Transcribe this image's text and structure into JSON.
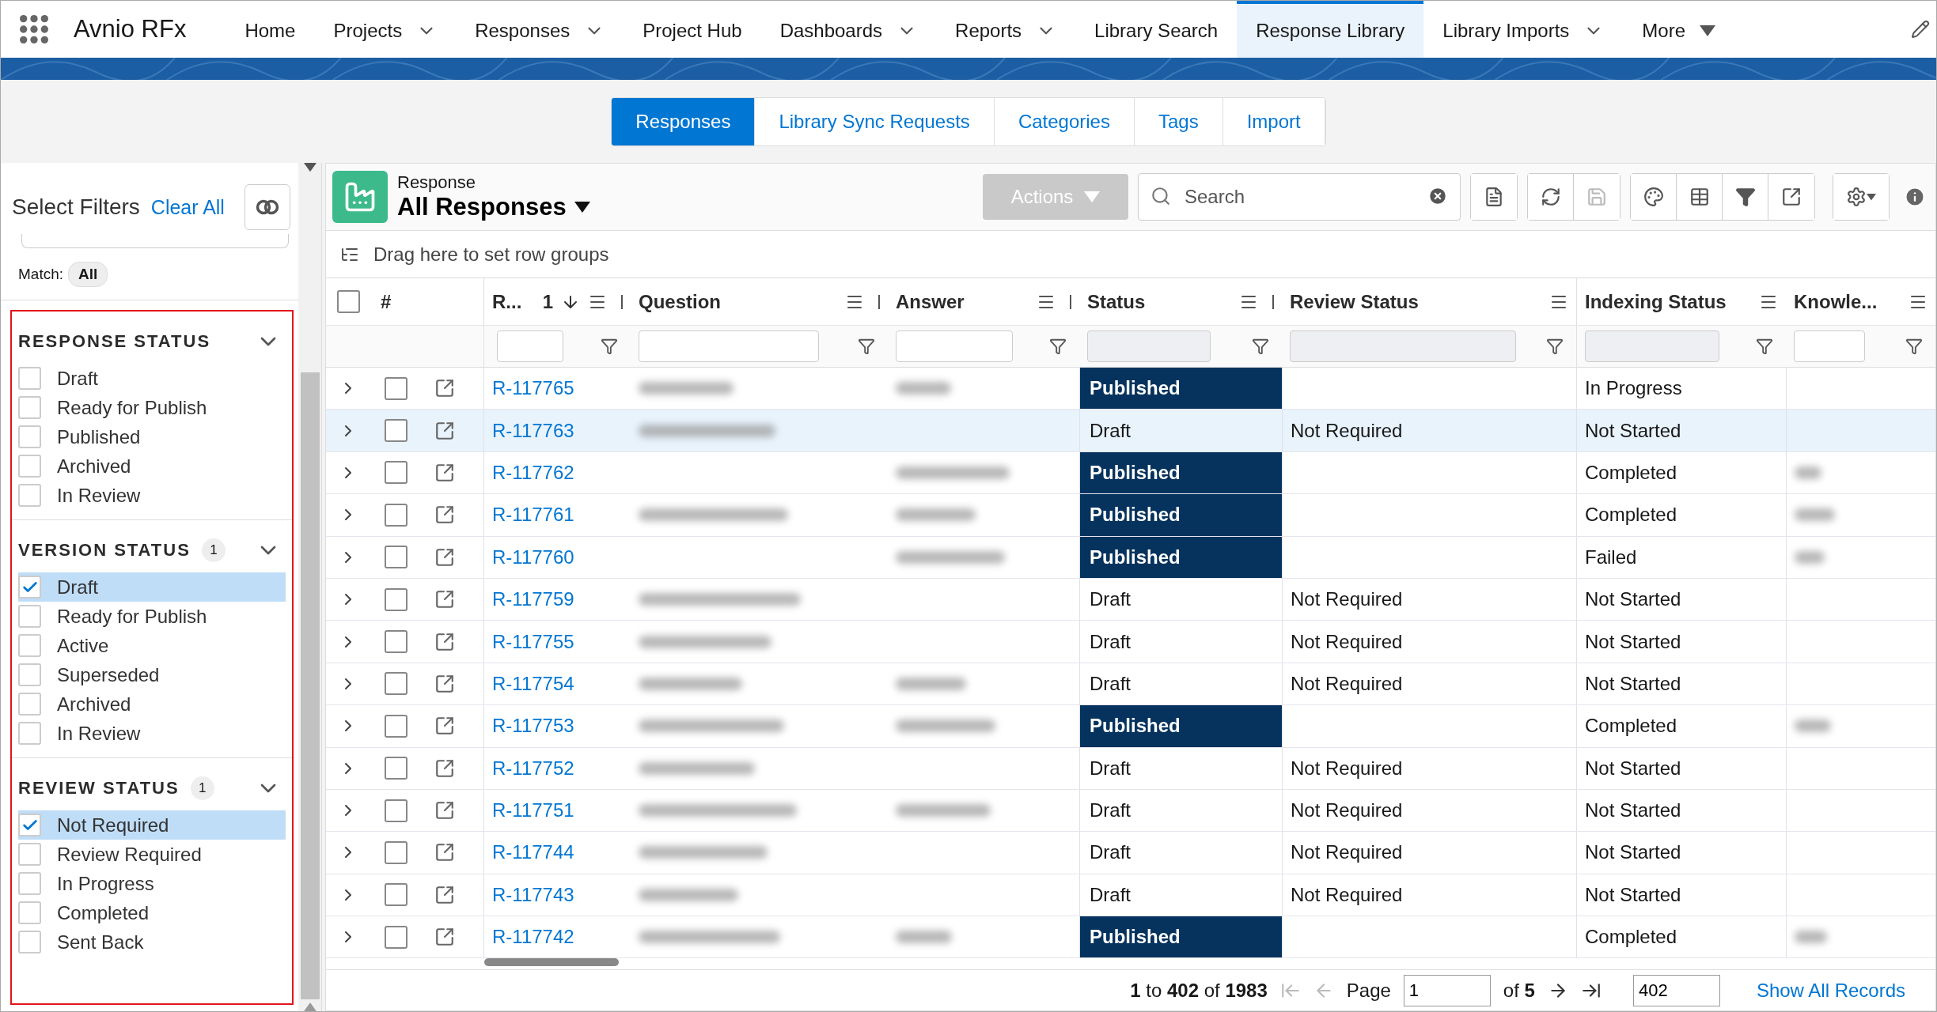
{
  "app": {
    "name": "Avnio RFx"
  },
  "nav": [
    {
      "label": "Home",
      "kind": "plain",
      "selected": false
    },
    {
      "label": "Projects",
      "kind": "chevron",
      "selected": false
    },
    {
      "label": "Responses",
      "kind": "chevron",
      "selected": false
    },
    {
      "label": "Project Hub",
      "kind": "plain",
      "selected": false
    },
    {
      "label": "Dashboards",
      "kind": "chevron",
      "selected": false
    },
    {
      "label": "Reports",
      "kind": "chevron",
      "selected": false
    },
    {
      "label": "Library Search",
      "kind": "plain",
      "selected": false
    },
    {
      "label": "Response Library",
      "kind": "plain",
      "selected": true
    },
    {
      "label": "Library Imports",
      "kind": "chevron",
      "selected": false
    },
    {
      "label": "More",
      "kind": "caret",
      "selected": false
    }
  ],
  "subtabs": [
    {
      "label": "Responses",
      "selected": true
    },
    {
      "label": "Library Sync Requests",
      "selected": false
    },
    {
      "label": "Categories",
      "selected": false
    },
    {
      "label": "Tags",
      "selected": false
    },
    {
      "label": "Import",
      "selected": false
    }
  ],
  "filters": {
    "title": "Select Filters",
    "clear": "Clear All",
    "match_label": "Match:",
    "match_value": "All",
    "sections": [
      {
        "title": "RESPONSE STATUS",
        "expanded": true,
        "options": [
          {
            "label": "Draft",
            "checked": false
          },
          {
            "label": "Ready for Publish",
            "checked": false
          },
          {
            "label": "Published",
            "checked": false
          },
          {
            "label": "Archived",
            "checked": false
          },
          {
            "label": "In Review",
            "checked": false
          }
        ]
      },
      {
        "title": "VERSION STATUS",
        "count": "1",
        "expanded": true,
        "options": [
          {
            "label": "Draft",
            "checked": true
          },
          {
            "label": "Ready for Publish",
            "checked": false
          },
          {
            "label": "Active",
            "checked": false
          },
          {
            "label": "Superseded",
            "checked": false
          },
          {
            "label": "Archived",
            "checked": false
          },
          {
            "label": "In Review",
            "checked": false
          }
        ]
      },
      {
        "title": "REVIEW STATUS",
        "count": "1",
        "expanded": true,
        "options": [
          {
            "label": "Not Required",
            "checked": true
          },
          {
            "label": "Review Required",
            "checked": false
          },
          {
            "label": "In Progress",
            "checked": false
          },
          {
            "label": "Completed",
            "checked": false
          },
          {
            "label": "Sent Back",
            "checked": false
          }
        ]
      }
    ]
  },
  "list": {
    "object": "Response",
    "view": "All Responses",
    "actions": "Actions",
    "search_placeholder": "Search",
    "group_hint": "Drag here to set row groups"
  },
  "table": {
    "select_label": "#",
    "select_all_checked": false,
    "columns": [
      {
        "label": "R...",
        "sort_rank": "1",
        "sort_descending": true,
        "filter_disabled": false
      },
      {
        "label": "Question",
        "filter_disabled": false
      },
      {
        "label": "Answer",
        "filter_disabled": false
      },
      {
        "label": "Status",
        "filter_disabled": true
      },
      {
        "label": "Review Status",
        "filter_disabled": true
      },
      {
        "label": "Indexing Status",
        "filter_disabled": true
      },
      {
        "label": "Knowle...",
        "filter_disabled": false
      }
    ],
    "rows": [
      {
        "id": "R-117765",
        "question_blurred": true,
        "answer_blurred": true,
        "status": "Published",
        "status_highlighted": true,
        "indexing": "In Progress",
        "knowledge_blurred": false,
        "highlighted": false
      },
      {
        "id": "R-117763",
        "question_blurred": true,
        "answer_blurred": false,
        "status": "Draft",
        "status_highlighted": false,
        "review": "Not Required",
        "indexing": "Not Started",
        "knowledge_blurred": false,
        "highlighted": true
      },
      {
        "id": "R-117762",
        "question_blurred": false,
        "answer_blurred": true,
        "status": "Published",
        "status_highlighted": true,
        "indexing": "Completed",
        "knowledge_blurred": true,
        "highlighted": false
      },
      {
        "id": "R-117761",
        "question_blurred": true,
        "answer_blurred": true,
        "status": "Published",
        "status_highlighted": true,
        "indexing": "Completed",
        "knowledge_blurred": true,
        "highlighted": false
      },
      {
        "id": "R-117760",
        "question_blurred": false,
        "answer_blurred": true,
        "status": "Published",
        "status_highlighted": true,
        "indexing": "Failed",
        "knowledge_blurred": true,
        "highlighted": false
      },
      {
        "id": "R-117759",
        "question_blurred": true,
        "answer_blurred": false,
        "status": "Draft",
        "status_highlighted": false,
        "review": "Not Required",
        "indexing": "Not Started",
        "knowledge_blurred": false,
        "highlighted": false
      },
      {
        "id": "R-117755",
        "question_blurred": true,
        "answer_blurred": false,
        "status": "Draft",
        "status_highlighted": false,
        "review": "Not Required",
        "indexing": "Not Started",
        "knowledge_blurred": false,
        "highlighted": false
      },
      {
        "id": "R-117754",
        "question_blurred": true,
        "answer_blurred": true,
        "status": "Draft",
        "status_highlighted": false,
        "review": "Not Required",
        "indexing": "Not Started",
        "knowledge_blurred": false,
        "highlighted": false
      },
      {
        "id": "R-117753",
        "question_blurred": true,
        "answer_blurred": true,
        "status": "Published",
        "status_highlighted": true,
        "indexing": "Completed",
        "knowledge_blurred": true,
        "highlighted": false
      },
      {
        "id": "R-117752",
        "question_blurred": true,
        "answer_blurred": false,
        "status": "Draft",
        "status_highlighted": false,
        "review": "Not Required",
        "indexing": "Not Started",
        "knowledge_blurred": false,
        "highlighted": false
      },
      {
        "id": "R-117751",
        "question_blurred": true,
        "answer_blurred": true,
        "status": "Draft",
        "status_highlighted": false,
        "review": "Not Required",
        "indexing": "Not Started",
        "knowledge_blurred": false,
        "highlighted": false
      },
      {
        "id": "R-117744",
        "question_blurred": true,
        "answer_blurred": false,
        "status": "Draft",
        "status_highlighted": false,
        "review": "Not Required",
        "indexing": "Not Started",
        "knowledge_blurred": false,
        "highlighted": false
      },
      {
        "id": "R-117743",
        "question_blurred": true,
        "answer_blurred": false,
        "status": "Draft",
        "status_highlighted": false,
        "review": "Not Required",
        "indexing": "Not Started",
        "knowledge_blurred": false,
        "highlighted": false
      },
      {
        "id": "R-117742",
        "question_blurred": true,
        "answer_blurred": true,
        "status": "Published",
        "status_highlighted": true,
        "indexing": "Completed",
        "knowledge_blurred": true,
        "highlighted": false
      }
    ]
  },
  "pager": {
    "range": "**1** to **402** of **1983**",
    "page_label": "Page",
    "page": "1",
    "of": "of **5**",
    "page_size": "402",
    "show_all": "Show All Records"
  }
}
